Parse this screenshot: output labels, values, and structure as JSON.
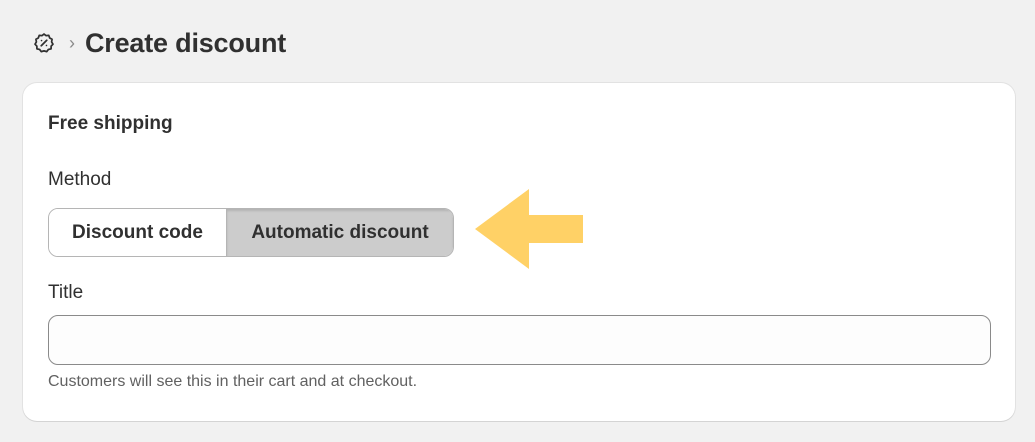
{
  "header": {
    "icon": "discount-icon",
    "separator": "›",
    "title": "Create discount"
  },
  "card": {
    "heading": "Free shipping",
    "method": {
      "label": "Method",
      "options": [
        {
          "label": "Discount code",
          "selected": false
        },
        {
          "label": "Automatic discount",
          "selected": true
        }
      ],
      "annotation": {
        "icon": "left-arrow-pointer-icon",
        "color": "#FFD166"
      }
    },
    "title_field": {
      "label": "Title",
      "value": "",
      "placeholder": "",
      "help_text": "Customers will see this in their cart and at checkout."
    }
  },
  "colors": {
    "background": "#F1F1F1",
    "card": "#FFFFFF",
    "selected_segment": "#CCCCCC",
    "text": "#303030",
    "muted_text": "#616161"
  }
}
